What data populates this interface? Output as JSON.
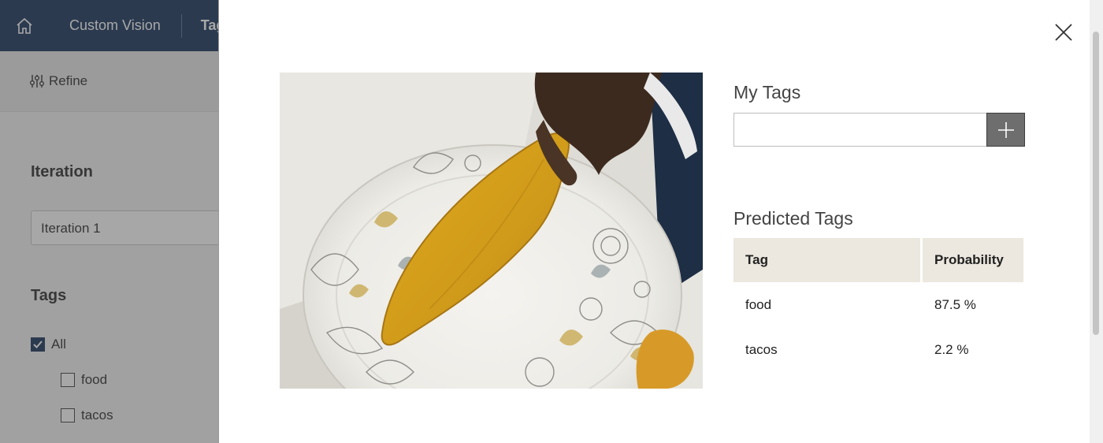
{
  "app": {
    "breadcrumb": [
      "Custom Vision",
      "Tag"
    ],
    "toolbar": {
      "refine_label": "Refine"
    },
    "sidebar": {
      "iteration_title": "Iteration",
      "iteration_value": "Iteration 1",
      "tags_title": "Tags",
      "filters": [
        {
          "label": "All",
          "checked": true
        },
        {
          "label": "food",
          "checked": false
        },
        {
          "label": "tacos",
          "checked": false
        }
      ]
    }
  },
  "modal": {
    "image_icon": "taco-on-paper-plate-photo",
    "my_tags": {
      "title": "My Tags",
      "input_value": "",
      "add_icon": "plus-icon"
    },
    "predicted_tags": {
      "title": "Predicted Tags",
      "columns": [
        "Tag",
        "Probability"
      ],
      "rows": [
        {
          "tag": "food",
          "probability": "87.5 %"
        },
        {
          "tag": "tacos",
          "probability": "2.2 %"
        }
      ]
    },
    "close_icon": "close-icon"
  },
  "colors": {
    "topbar": "#1e3a5f",
    "header_bg": "#ece8df",
    "add_button": "#6e6e6e"
  }
}
